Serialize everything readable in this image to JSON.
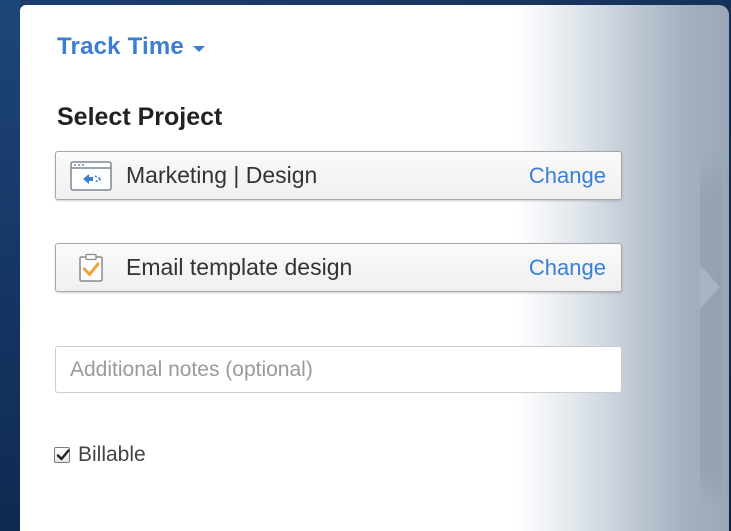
{
  "header": {
    "title": "Track Time",
    "dropdown_icon": "caret-down-icon"
  },
  "section": {
    "heading": "Select Project"
  },
  "project_selector": {
    "icon": "project-window-icon",
    "label": "Marketing | Design",
    "change_label": "Change"
  },
  "task_selector": {
    "icon": "task-clipboard-check-icon",
    "label": "Email template design",
    "change_label": "Change"
  },
  "notes": {
    "placeholder": "Additional notes (optional)",
    "value": ""
  },
  "billable": {
    "label": "Billable",
    "checked": true
  },
  "colors": {
    "accent": "#3a7fd5",
    "task_icon": "#f0a23b",
    "background": "#132d52"
  }
}
